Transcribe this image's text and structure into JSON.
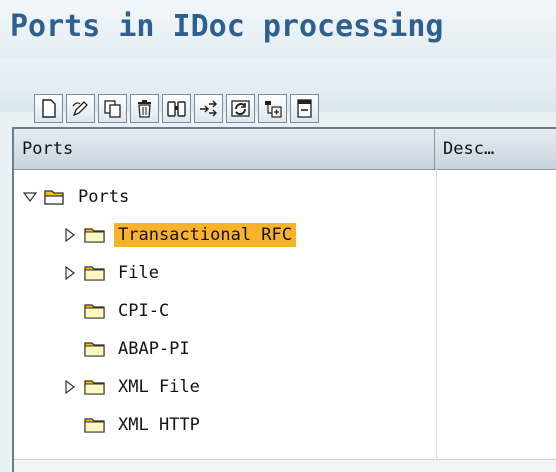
{
  "page": {
    "title": "Ports in IDoc processing"
  },
  "toolbar": {
    "buttons": [
      {
        "name": "create-button",
        "icon": "new-document-icon"
      },
      {
        "name": "change-button",
        "icon": "pencil-icon"
      },
      {
        "name": "copy-button",
        "icon": "copy-icon"
      },
      {
        "name": "delete-button",
        "icon": "trash-icon"
      },
      {
        "name": "find-button",
        "icon": "binoculars-icon"
      },
      {
        "name": "transfer-button",
        "icon": "transport-arrows-icon"
      },
      {
        "name": "refresh-button",
        "icon": "refresh-icon"
      },
      {
        "name": "expand-button",
        "icon": "expand-subtree-icon"
      },
      {
        "name": "collapse-button",
        "icon": "collapse-subtree-icon"
      }
    ]
  },
  "tree": {
    "columns": [
      "Ports",
      "Desc…"
    ],
    "root": {
      "label": "Ports",
      "expanded": true
    },
    "items": [
      {
        "label": "Transactional RFC",
        "expandable": true,
        "selected": true
      },
      {
        "label": "File",
        "expandable": true,
        "selected": false
      },
      {
        "label": "CPI-C",
        "expandable": false,
        "selected": false
      },
      {
        "label": "ABAP-PI",
        "expandable": false,
        "selected": false
      },
      {
        "label": "XML File",
        "expandable": true,
        "selected": false
      },
      {
        "label": "XML HTTP",
        "expandable": false,
        "selected": false
      }
    ]
  },
  "colors": {
    "title": "#2f5f8f",
    "selection": "#f9b32b",
    "folder": "#f5c400"
  }
}
